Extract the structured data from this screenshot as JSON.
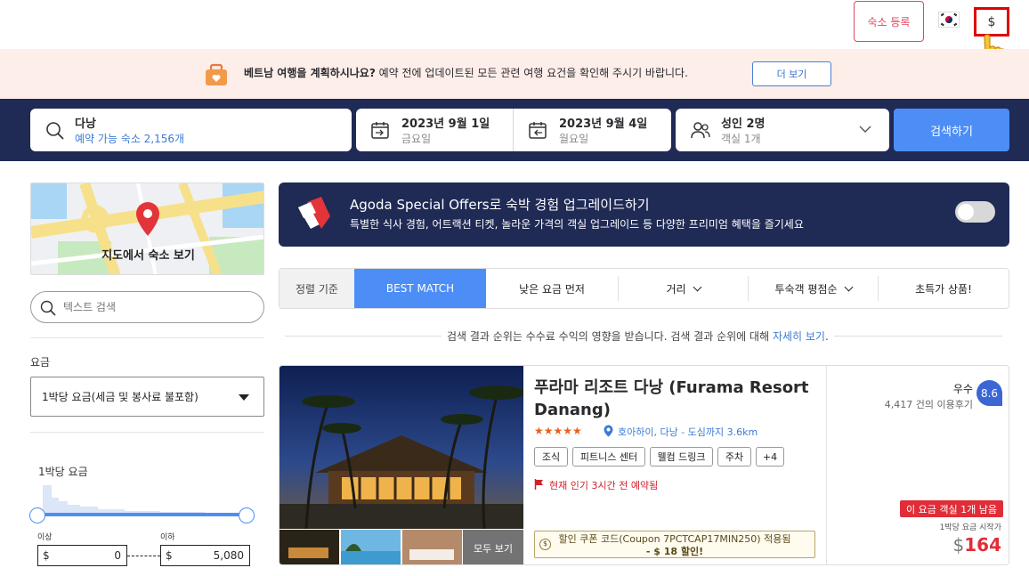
{
  "topbar": {
    "register_label": "숙소 등록",
    "currency_symbol": "$"
  },
  "notice": {
    "bold_text": "베트남 여행을 계획하시나요?",
    "text": " 예약 전에 업데이트된 모든 관련 여행 요건을 확인해 주시기 바랍니다.",
    "more_label": "더 보기"
  },
  "search": {
    "destination": "다낭",
    "availability": "예약 가능 숙소 2,156개",
    "checkin_date": "2023년 9월 1일",
    "checkin_day": "금요일",
    "checkout_date": "2023년 9월 4일",
    "checkout_day": "월요일",
    "guests": "성인 2명",
    "rooms": "객실 1개",
    "search_label": "검색하기"
  },
  "sidebar": {
    "map_label": "지도에서 숙소 보기",
    "text_search_placeholder": "텍스트 검색",
    "price_heading": "요금",
    "price_mode": "1박당 요금(세금 및 봉사료 불포함)",
    "nightly_label": "1박당 요금",
    "min_label": "이상",
    "max_label": "이하",
    "currency": "$",
    "min_value": "0",
    "max_value": "5,080"
  },
  "offers": {
    "title": "Agoda Special Offers로 숙박 경험 업그레이드하기",
    "description": "특별한 식사 경험, 어트랙션 티켓, 놀라운 가격의 객실 업그레이드 등 다양한 프리미엄 혜택을 즐기세요"
  },
  "sort": {
    "label": "정렬 기준",
    "best_match": "BEST MATCH",
    "lowest_price": "낮은 요금 먼저",
    "distance": "거리",
    "guest_rating": "투숙객 평점순",
    "deals": "초특가 상품!"
  },
  "disclaimer": {
    "text": "검색 결과 순위는 수수료 수익의 영향을 받습니다. 검색 결과 순위에 대해 ",
    "link": "자세히 보기",
    "end": "."
  },
  "hotel": {
    "name": "푸라마 리조트 다낭 (Furama Resort Danang)",
    "stars": "★★★★★",
    "location": "호아하이, 다낭 - 도심까지 3.6km",
    "tags": [
      "조식",
      "피트니스 센터",
      "웰컴 드링크",
      "주차",
      "+4"
    ],
    "popular": "현재 인기 3시간 전 예약됨",
    "see_all": "모두 보기",
    "coupon_line1": "할인 쿠폰 코드(Coupon 7PCTCAP17MIN250) 적용됨",
    "coupon_line2": "- $ 18 할인!",
    "rating_word": "우수",
    "review_count": "4,417 건의 이용후기",
    "rating": "8.6",
    "rooms_left": "이 요금 객실 1개 남음",
    "price_note": "1박당 요금 시작가",
    "price_currency": "$",
    "price": "164"
  },
  "colors": {
    "navy": "#1f2a55",
    "accent_blue": "#4d8ef6",
    "brand_red": "#e0485e",
    "price_red": "#e12d38",
    "notice_bg": "#fdeee9"
  }
}
